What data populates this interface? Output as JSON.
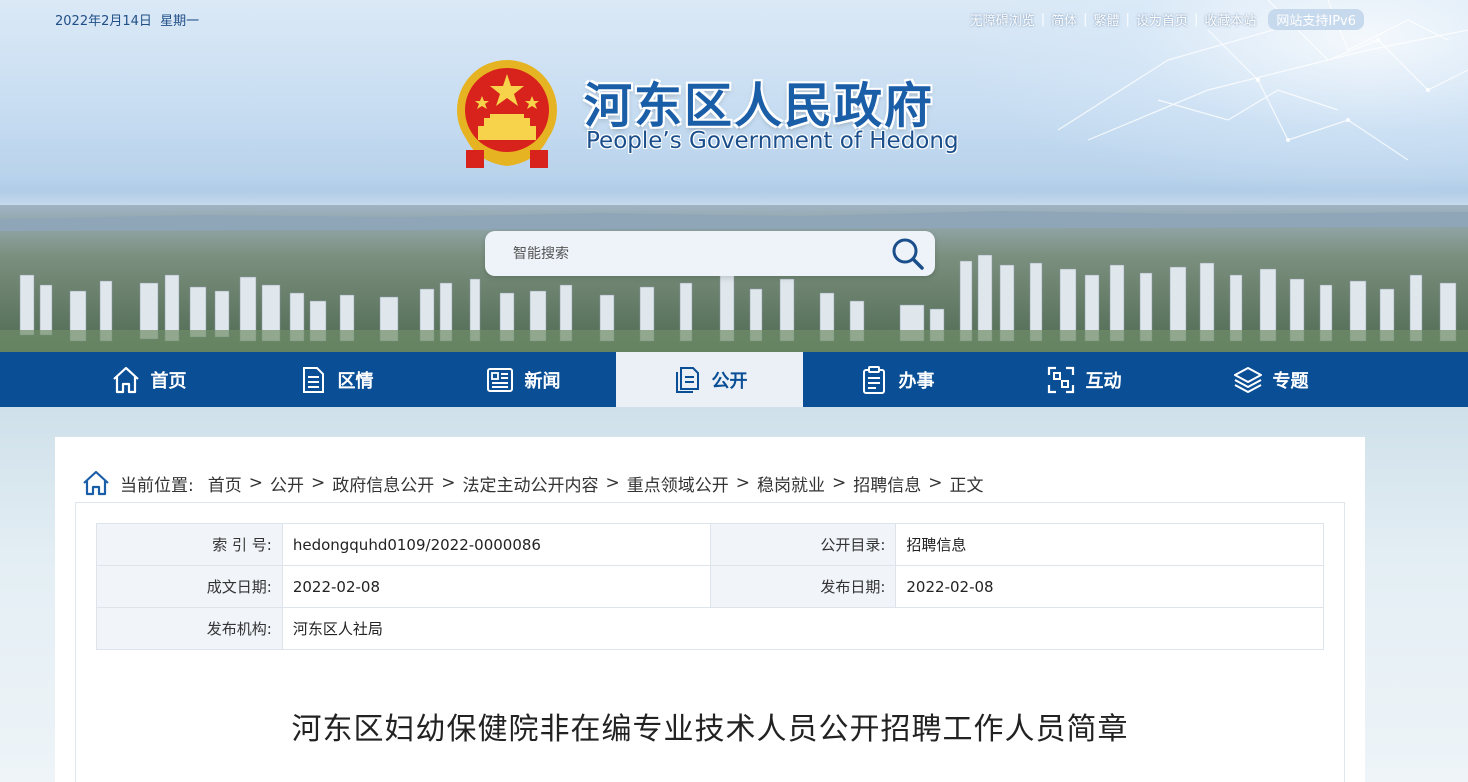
{
  "header": {
    "date": "2022年2月14日",
    "weekday": "星期一",
    "links": [
      "无障碍浏览",
      "简体",
      "繁體",
      "设为首页",
      "收藏本站"
    ],
    "ipv6_badge": "网站支持IPv6",
    "site_title": "河东区人民政府",
    "site_subtitle": "People’s Government of Hedong"
  },
  "search": {
    "placeholder": "智能搜索"
  },
  "nav": {
    "items": [
      {
        "label": "首页",
        "icon": "home-icon"
      },
      {
        "label": "区情",
        "icon": "document-icon"
      },
      {
        "label": "新闻",
        "icon": "newspaper-icon"
      },
      {
        "label": "公开",
        "icon": "files-icon",
        "active": true
      },
      {
        "label": "办事",
        "icon": "clipboard-icon"
      },
      {
        "label": "互动",
        "icon": "interact-icon"
      },
      {
        "label": "专题",
        "icon": "layers-icon"
      }
    ]
  },
  "breadcrumb": {
    "label": "当前位置:",
    "items": [
      "首页",
      "公开",
      "政府信息公开",
      "法定主动公开内容",
      "重点领域公开",
      "稳岗就业",
      "招聘信息",
      "正文"
    ],
    "separator": ">"
  },
  "meta": {
    "index_no_label": "索 引 号:",
    "index_no": "hedongquhd0109/2022-0000086",
    "catalog_label": "公开目录:",
    "catalog": "招聘信息",
    "created_label": "成文日期:",
    "created": "2022-02-08",
    "published_label": "发布日期:",
    "published": "2022-02-08",
    "publisher_label": "发布机构:",
    "publisher": "河东区人社局"
  },
  "article": {
    "title": "河东区妇幼保健院非在编专业技术人员公开招聘工作人员简章"
  },
  "colors": {
    "nav_bg": "#0a4e96",
    "nav_active_bg": "#eaf0f6",
    "title_blue": "#1b5ea8"
  }
}
